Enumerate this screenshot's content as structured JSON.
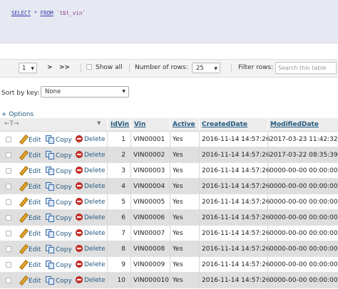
{
  "sql": {
    "kw_select": "SELECT",
    "star": " * ",
    "kw_from": "FROM",
    "table": " `tbl_vin`"
  },
  "nav": {
    "page": "1",
    "next": ">",
    "last": ">>",
    "show_all": "Show all",
    "num_rows_label": "Number of rows:",
    "num_rows": "25",
    "filter_label": "Filter rows:",
    "filter_placeholder": "Search this table"
  },
  "sort": {
    "label": "Sort by key:",
    "value": "None"
  },
  "options_label": "+ Options",
  "actions": {
    "edit": "Edit",
    "copy": "Copy",
    "delete": "Delete"
  },
  "columns": [
    "IdVin",
    "Vin",
    "Active",
    "CreatedDate",
    "ModifiedDate"
  ],
  "rows": [
    {
      "id": "1",
      "vin": "VIN00001",
      "active": "Yes",
      "created": "2016-11-14 14:57:26",
      "modified": "2017-03-23 11:42:32"
    },
    {
      "id": "2",
      "vin": "VIN00002",
      "active": "Yes",
      "created": "2016-11-14 14:57:26",
      "modified": "2017-03-22 08:35:39"
    },
    {
      "id": "3",
      "vin": "VIN00003",
      "active": "Yes",
      "created": "2016-11-14 14:57:26",
      "modified": "0000-00-00 00:00:00"
    },
    {
      "id": "4",
      "vin": "VIN00004",
      "active": "Yes",
      "created": "2016-11-14 14:57:26",
      "modified": "0000-00-00 00:00:00"
    },
    {
      "id": "5",
      "vin": "VIN00005",
      "active": "Yes",
      "created": "2016-11-14 14:57:26",
      "modified": "0000-00-00 00:00:00"
    },
    {
      "id": "6",
      "vin": "VIN00006",
      "active": "Yes",
      "created": "2016-11-14 14:57:26",
      "modified": "0000-00-00 00:00:00"
    },
    {
      "id": "7",
      "vin": "VIN00007",
      "active": "Yes",
      "created": "2016-11-14 14:57:26",
      "modified": "0000-00-00 00:00:00"
    },
    {
      "id": "8",
      "vin": "VIN00008",
      "active": "Yes",
      "created": "2016-11-14 14:57:26",
      "modified": "0000-00-00 00:00:00"
    },
    {
      "id": "9",
      "vin": "VIN00009",
      "active": "Yes",
      "created": "2016-11-14 14:57:26",
      "modified": "0000-00-00 00:00:00"
    },
    {
      "id": "10",
      "vin": "VIN000010",
      "active": "Yes",
      "created": "2016-11-14 14:57:26",
      "modified": "0000-00-00 00:00:00"
    }
  ]
}
